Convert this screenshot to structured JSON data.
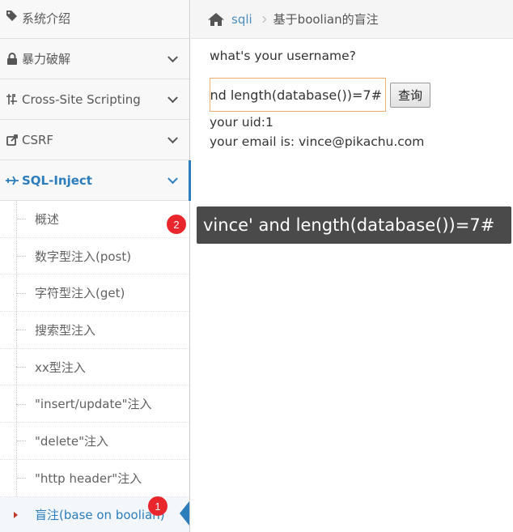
{
  "sidebar": {
    "items": [
      {
        "label": "系统介绍",
        "icon": "tags-icon"
      },
      {
        "label": "暴力破解",
        "icon": "lock-icon"
      },
      {
        "label": "Cross-Site Scripting",
        "icon": "filter-icon"
      },
      {
        "label": "CSRF",
        "icon": "share-icon"
      },
      {
        "label": "SQL-Inject",
        "icon": "plane-icon"
      }
    ],
    "submenu": [
      "概述",
      "数字型注入(post)",
      "字符型注入(get)",
      "搜索型注入",
      "xx型注入",
      "\"insert/update\"注入",
      "\"delete\"注入",
      "\"http header\"注入",
      "盲注(base on boolian)"
    ]
  },
  "breadcrumb": {
    "link": "sqli",
    "current": "基于boolian的盲注"
  },
  "main": {
    "question": "what's your username?",
    "input_value": "vince' and length(database())=7#",
    "button_label": "查询",
    "uid_line": "your uid:1",
    "email_line": "your email is: vince@pikachu.com"
  },
  "annotations": {
    "tooltip_text": "vince' and length(database())=7#",
    "badge_1": "1",
    "badge_2": "2"
  },
  "colors": {
    "accent": "#2b7dbc",
    "badge": "#e8262c",
    "tooltip_bg": "#4a4a4a",
    "input_border": "#f0ad70"
  }
}
